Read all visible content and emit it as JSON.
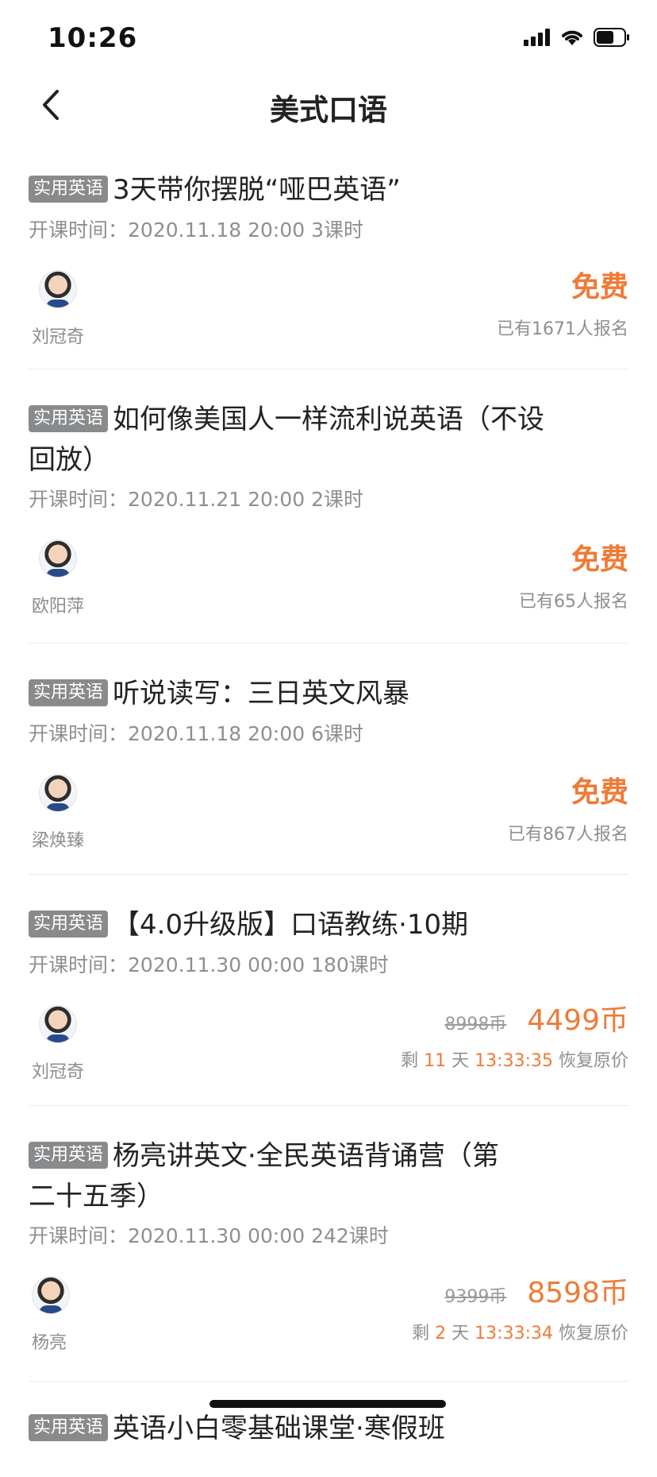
{
  "status_bar": {
    "time": "10:26"
  },
  "nav": {
    "title": "美式口语"
  },
  "courses": [
    {
      "tag": "实用英语",
      "title": "3天带你摆脱“哑巴英语”",
      "time_label": "开课时间：",
      "schedule": "2020.11.18 20:00 3课时",
      "teacher": "刘冠奇",
      "price": "免费",
      "enroll": "已有1671人报名"
    },
    {
      "tag": "实用英语",
      "title": "如何像美国人一样流利说英语（不设回放）",
      "time_label": "开课时间：",
      "schedule": "2020.11.21 20:00 2课时",
      "teacher": "欧阳萍",
      "price": "免费",
      "enroll": "已有65人报名"
    },
    {
      "tag": "实用英语",
      "title": "听说读写：三日英文风暴",
      "time_label": "开课时间：",
      "schedule": "2020.11.18 20:00 6课时",
      "teacher": "梁焕臻",
      "price": "免费",
      "enroll": "已有867人报名"
    },
    {
      "tag": "实用英语",
      "title": "【4.0升级版】口语教练·10期",
      "time_label": "开课时间：",
      "schedule": "2020.11.30 00:00 180课时",
      "teacher": "刘冠奇",
      "original_price": "8998币",
      "sale_price": "4499币",
      "countdown": {
        "prefix": "剩",
        "days": "11",
        "days_unit": "天",
        "time": "13:33:35",
        "suffix": "恢复原价"
      }
    },
    {
      "tag": "实用英语",
      "title": "杨亮讲英文·全民英语背诵营（第二十五季）",
      "time_label": "开课时间：",
      "schedule": "2020.11.30 00:00 242课时",
      "teacher": "杨亮",
      "original_price": "9399币",
      "sale_price": "8598币",
      "countdown": {
        "prefix": "剩",
        "days": "2",
        "days_unit": "天",
        "time": "13:33:34",
        "suffix": "恢复原价"
      }
    },
    {
      "tag": "实用英语",
      "title": "英语小白零基础课堂·寒假班"
    }
  ],
  "colors": {
    "accent": "#f07a35",
    "tag_bg": "#888a8c",
    "divider": "#ececec"
  }
}
